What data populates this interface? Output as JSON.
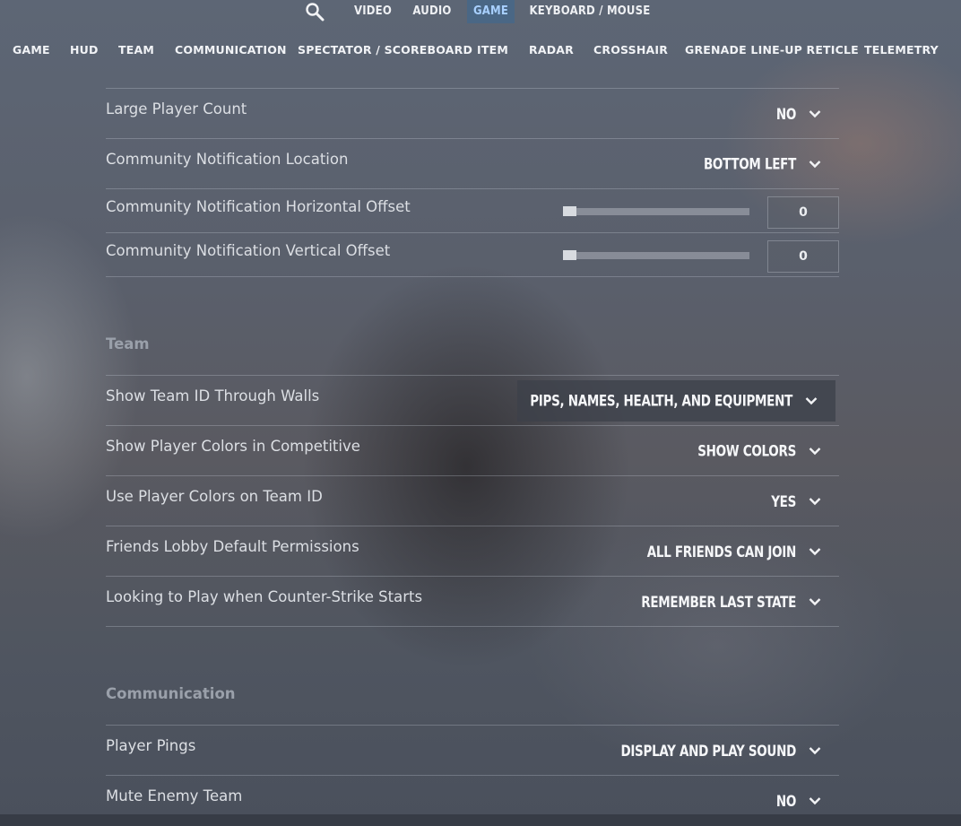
{
  "top_tabs": [
    {
      "label": "VIDEO"
    },
    {
      "label": "AUDIO"
    },
    {
      "label": "GAME",
      "active": true
    },
    {
      "label": "KEYBOARD / MOUSE"
    }
  ],
  "sub_tabs": [
    "GAME",
    "HUD",
    "TEAM",
    "COMMUNICATION",
    "SPECTATOR / SCOREBOARD",
    "ITEM",
    "RADAR",
    "CROSSHAIR",
    "GRENADE LINE-UP RETICLE",
    "TELEMETRY"
  ],
  "hud_rows": [
    {
      "label": "Large Player Count",
      "value": "NO"
    },
    {
      "label": "Community Notification Location",
      "value": "BOTTOM LEFT"
    },
    {
      "label": "Community Notification Horizontal Offset",
      "slider_value": "0",
      "slider_fraction": 0
    },
    {
      "label": "Community Notification Vertical Offset",
      "slider_value": "0",
      "slider_fraction": 0
    }
  ],
  "team": {
    "title": "Team",
    "rows": [
      {
        "label": "Show Team ID Through Walls",
        "value": "PIPS, NAMES, HEALTH, AND EQUIPMENT",
        "highlighted": true
      },
      {
        "label": "Show Player Colors in Competitive",
        "value": "SHOW COLORS"
      },
      {
        "label": "Use Player Colors on Team ID",
        "value": "YES"
      },
      {
        "label": "Friends Lobby Default Permissions",
        "value": "ALL FRIENDS CAN JOIN"
      },
      {
        "label": "Looking to Play when Counter-Strike Starts",
        "value": "REMEMBER LAST STATE"
      }
    ]
  },
  "communication": {
    "title": "Communication",
    "rows": [
      {
        "label": "Player Pings",
        "value": "DISPLAY AND PLAY SOUND"
      },
      {
        "label": "Mute Enemy Team",
        "value": "NO"
      }
    ]
  },
  "colors": {
    "active_tab_bg": "#4a6785",
    "active_tab_text": "#a8d0ff"
  }
}
